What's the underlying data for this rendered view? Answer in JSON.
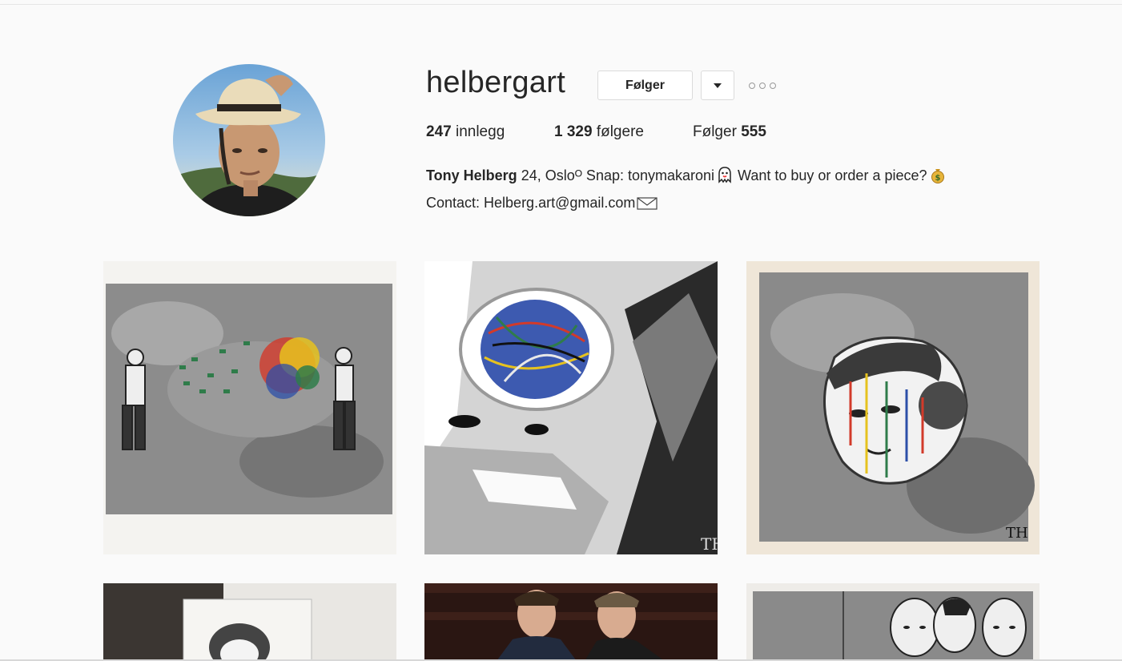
{
  "profile": {
    "username": "helbergart",
    "follow_label": "Følger",
    "stats": {
      "posts_count": "247",
      "posts_label": "innlegg",
      "followers_count": "1 329",
      "followers_label": "følgere",
      "following_label": "Følger",
      "following_count": "555"
    },
    "bio": {
      "name": "Tony Helberg",
      "line1": " 24, Osloᴼ Snap: tonymakaroni",
      "line1b": " Want to buy or order a piece?",
      "line2": "Contact: Helberg.art@gmail.com"
    }
  },
  "icons": {
    "dropdown": "chevron-down-icon",
    "more": "more-options-icon",
    "ghost": "ghost-emoji-icon",
    "moneybag": "money-bag-emoji-icon",
    "envelope": "envelope-emoji-icon"
  },
  "posts": [
    {
      "subject": "Two figures with colorful paint splash"
    },
    {
      "subject": "Face stencil with paint-splatter glasses"
    },
    {
      "subject": "Woman face stencil with paint drips"
    },
    {
      "subject": "Framed stencil art in gallery"
    },
    {
      "subject": "Two men in suits"
    },
    {
      "subject": "Three faces stencil"
    }
  ]
}
